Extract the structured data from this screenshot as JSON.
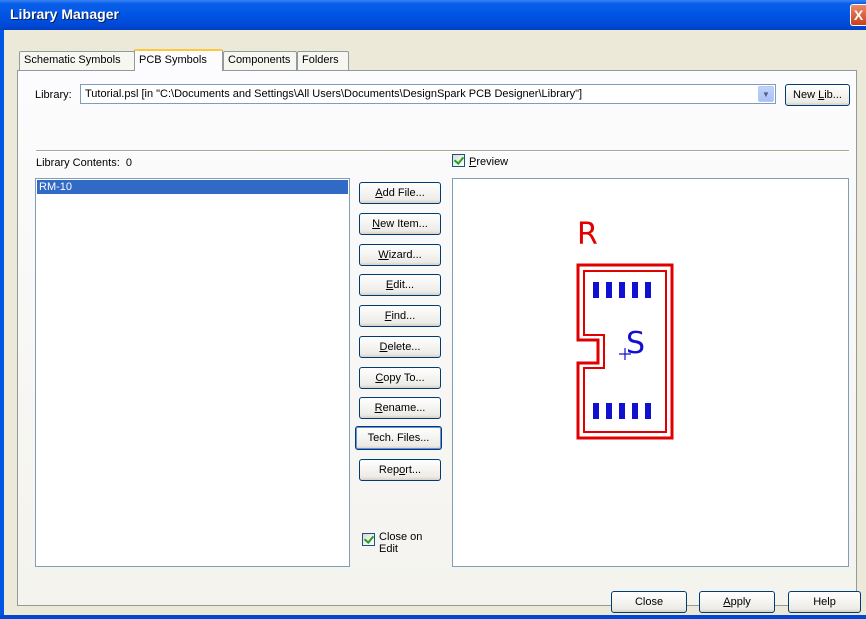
{
  "window": {
    "title": "Library Manager",
    "close_glyph": "X"
  },
  "tabs": [
    {
      "label": "Schematic Symbols"
    },
    {
      "label": "PCB Symbols"
    },
    {
      "label": "Components"
    },
    {
      "label": "Folders"
    }
  ],
  "library": {
    "label": "Library:",
    "value": "Tutorial.psl   [in \"C:\\Documents and Settings\\All Users\\Documents\\DesignSpark PCB Designer\\Library\"]",
    "new_lib_pre": "New ",
    "new_lib_key": "L",
    "new_lib_post": "ib..."
  },
  "contents": {
    "label": "Library Contents:",
    "count": "0",
    "items": [
      "RM-10"
    ]
  },
  "preview": {
    "label_key": "P",
    "label_rest": "review",
    "checked": true
  },
  "actions": {
    "add_file": [
      "A",
      "dd File..."
    ],
    "new_item": [
      "N",
      "ew Item..."
    ],
    "wizard": [
      "W",
      "izard..."
    ],
    "edit": [
      "E",
      "dit..."
    ],
    "find": [
      "F",
      "ind..."
    ],
    "delete": [
      "D",
      "elete..."
    ],
    "copy_to": [
      "C",
      "opy To..."
    ],
    "rename": [
      "R",
      "ename..."
    ],
    "tech_files": "Tech. Files...",
    "report_pre": "Rep",
    "report_key": "o",
    "report_post": "rt..."
  },
  "close_on_edit": {
    "line1": "Close on",
    "line2": "Edit",
    "checked": true
  },
  "footer": {
    "close": "Close",
    "apply_key": "A",
    "apply_rest": "pply",
    "help": "Help"
  },
  "footprint": {
    "ref_label": "R",
    "value_label": "S",
    "outline_color": "#e00000",
    "pad_color": "#1010d0",
    "text_color": "#e00000",
    "value_color": "#1010d0"
  }
}
